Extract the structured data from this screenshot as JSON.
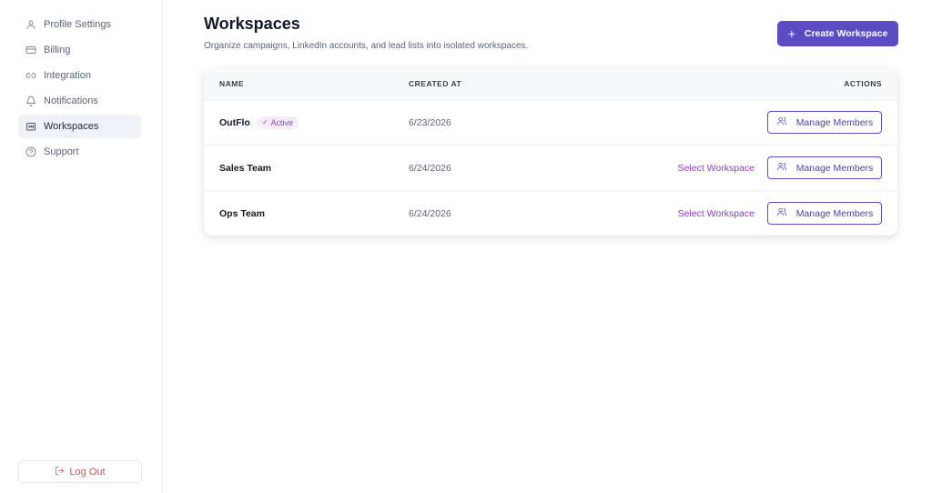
{
  "sidebar": {
    "items": [
      {
        "label": "Profile Settings",
        "icon": "user-icon"
      },
      {
        "label": "Billing",
        "icon": "credit-card-icon"
      },
      {
        "label": "Integration",
        "icon": "link-icon"
      },
      {
        "label": "Notifications",
        "icon": "bell-icon"
      },
      {
        "label": "Workspaces",
        "icon": "folder-icon",
        "active": true
      },
      {
        "label": "Support",
        "icon": "help-circle-icon"
      }
    ],
    "logout_label": "Log Out"
  },
  "header": {
    "title": "Workspaces",
    "subtitle": "Organize campaigns, LinkedIn accounts, and lead lists into isolated workspaces.",
    "create_label": "Create Workspace",
    "create_icon": "+"
  },
  "table": {
    "columns": {
      "name": "NAME",
      "created": "CREATED AT",
      "actions": "ACTIONS"
    },
    "rows": [
      {
        "name": "OutFlo",
        "badge": "Active",
        "created": "6/23/2026",
        "select_label": "",
        "manage_label": "Manage Members"
      },
      {
        "name": "Sales Team",
        "badge": "",
        "created": "6/24/2026",
        "select_label": "Select Workspace",
        "manage_label": "Manage Members"
      },
      {
        "name": "Ops Team",
        "badge": "",
        "created": "6/24/2026",
        "select_label": "Select Workspace",
        "manage_label": "Manage Members"
      }
    ]
  },
  "colors": {
    "accent": "#5b4cc4",
    "link": "#8a3fbf",
    "danger": "#ef4444"
  }
}
